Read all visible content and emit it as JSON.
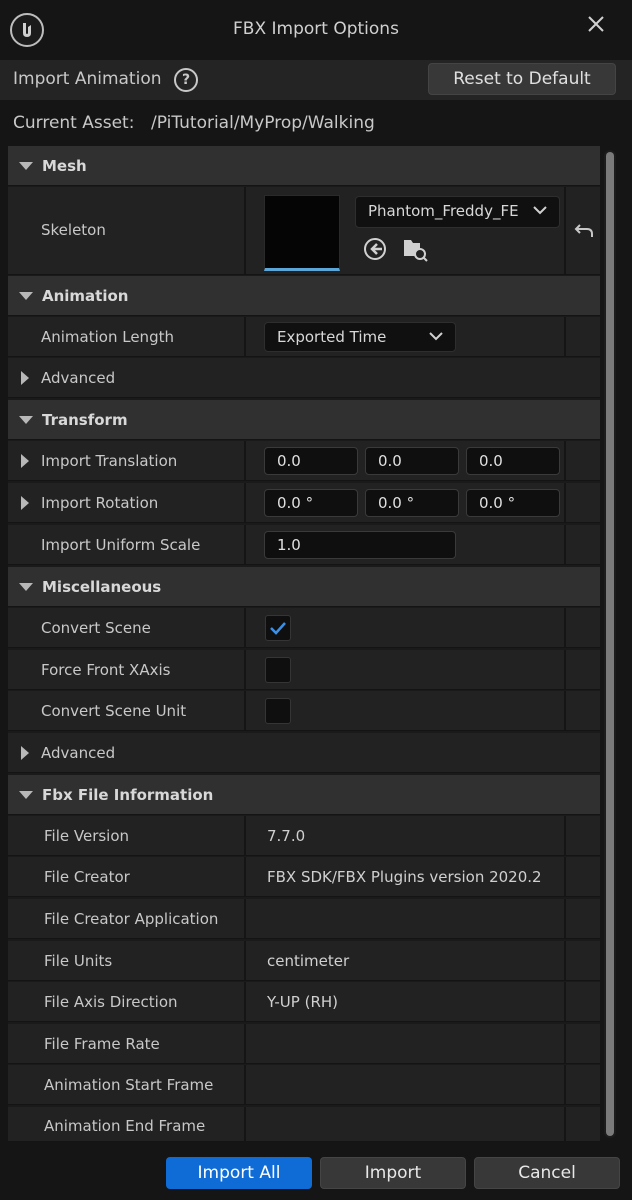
{
  "window": {
    "title": "FBX Import Options",
    "logo_icon": "unreal-logo-icon",
    "close_icon": "close-icon"
  },
  "top_bar": {
    "import_label": "Import Animation",
    "help_icon": "help-icon",
    "help_glyph": "?",
    "reset_label": "Reset to Default"
  },
  "asset": {
    "label": "Current Asset:",
    "path": "/PiTutorial/MyProp/Walking"
  },
  "sections": {
    "mesh": {
      "title": "Mesh",
      "skeleton_label": "Skeleton",
      "skeleton_value": "Phantom_Freddy_FE",
      "browse_icon": "use-selected-arrow-icon",
      "find_icon": "browse-folder-search-icon",
      "reset_icon": "reset-arrow-icon"
    },
    "animation": {
      "title": "Animation",
      "length_label": "Animation Length",
      "length_value": "Exported Time",
      "advanced_label": "Advanced"
    },
    "transform": {
      "title": "Transform",
      "translation_label": "Import Translation",
      "translation": [
        "0.0",
        "0.0",
        "0.0"
      ],
      "rotation_label": "Import Rotation",
      "rotation": [
        "0.0 °",
        "0.0 °",
        "0.0 °"
      ],
      "scale_label": "Import Uniform Scale",
      "scale_value": "1.0"
    },
    "misc": {
      "title": "Miscellaneous",
      "convert_scene_label": "Convert Scene",
      "convert_scene_checked": true,
      "force_front_label": "Force Front XAxis",
      "force_front_checked": false,
      "convert_unit_label": "Convert Scene Unit",
      "convert_unit_checked": false,
      "advanced_label": "Advanced"
    },
    "fbx_info": {
      "title": "Fbx File Information",
      "rows": [
        {
          "label": "File Version",
          "value": "7.7.0"
        },
        {
          "label": "File Creator",
          "value": "FBX SDK/FBX Plugins version 2020.2"
        },
        {
          "label": "File Creator Application",
          "value": ""
        },
        {
          "label": "File Units",
          "value": "centimeter"
        },
        {
          "label": "File Axis Direction",
          "value": "Y-UP (RH)"
        },
        {
          "label": "File Frame Rate",
          "value": ""
        },
        {
          "label": "Animation Start Frame",
          "value": ""
        },
        {
          "label": "Animation End Frame",
          "value": ""
        }
      ]
    }
  },
  "buttons": {
    "import_all": "Import All",
    "import": "Import",
    "cancel": "Cancel"
  },
  "colors": {
    "accent": "#0f6cd6",
    "check": "#3d8fe6"
  }
}
